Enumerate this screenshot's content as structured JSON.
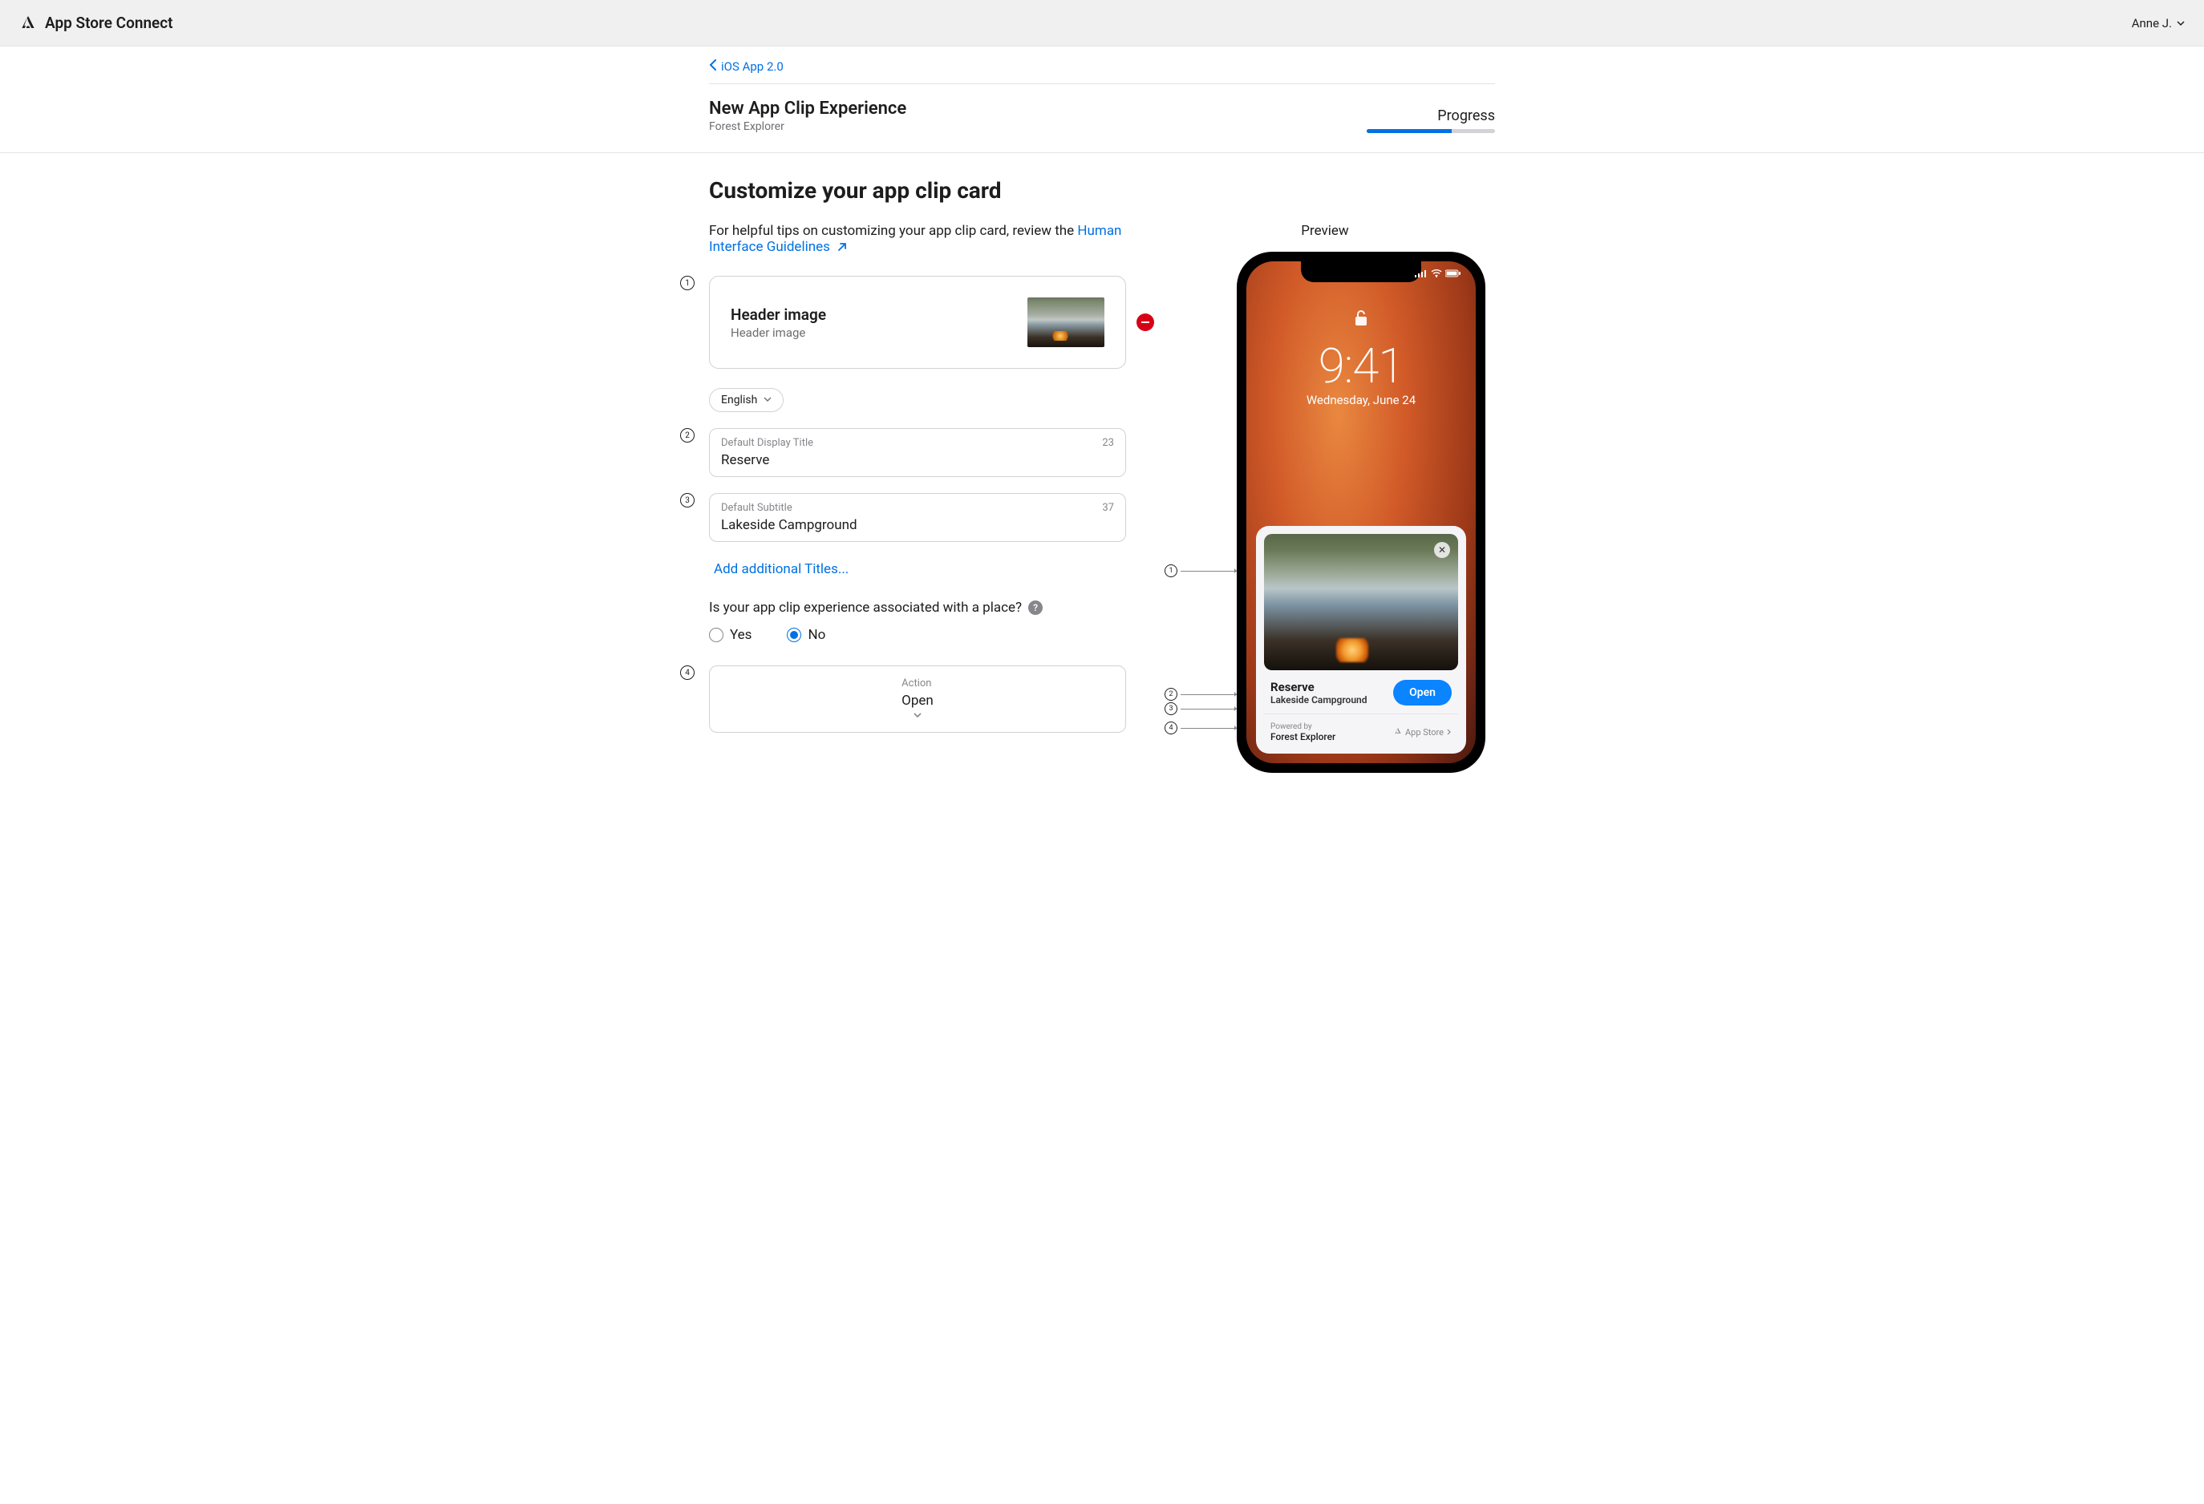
{
  "header": {
    "app_name": "App Store Connect",
    "user_name": "Anne J."
  },
  "breadcrumb": {
    "back_label": "iOS App 2.0"
  },
  "page": {
    "title": "New App Clip Experience",
    "subtitle": "Forest Explorer",
    "progress_label": "Progress",
    "progress_pct": 66
  },
  "content": {
    "heading": "Customize your app clip card",
    "help_prefix": "For helpful tips on customizing your app clip card, review the ",
    "help_link": "Human Interface Guidelines"
  },
  "form": {
    "header_image": {
      "title": "Header image",
      "subtitle": "Header image"
    },
    "language": {
      "value": "English"
    },
    "title_field": {
      "label": "Default Display Title",
      "value": "Reserve",
      "remaining": "23"
    },
    "subtitle_field": {
      "label": "Default Subtitle",
      "value": "Lakeside Campground",
      "remaining": "37"
    },
    "add_titles_link": "Add additional Titles...",
    "place_q": "Is your app clip experience associated with a place?",
    "radio_yes": "Yes",
    "radio_no": "No",
    "action_field": {
      "label": "Action",
      "value": "Open"
    }
  },
  "preview": {
    "label": "Preview",
    "lock_time": "9:41",
    "lock_date": "Wednesday, June 24",
    "card": {
      "title": "Reserve",
      "subtitle": "Lakeside Campground",
      "button": "Open",
      "powered_by_label": "Powered by",
      "powered_by_value": "Forest Explorer",
      "appstore_label": "App Store"
    }
  }
}
